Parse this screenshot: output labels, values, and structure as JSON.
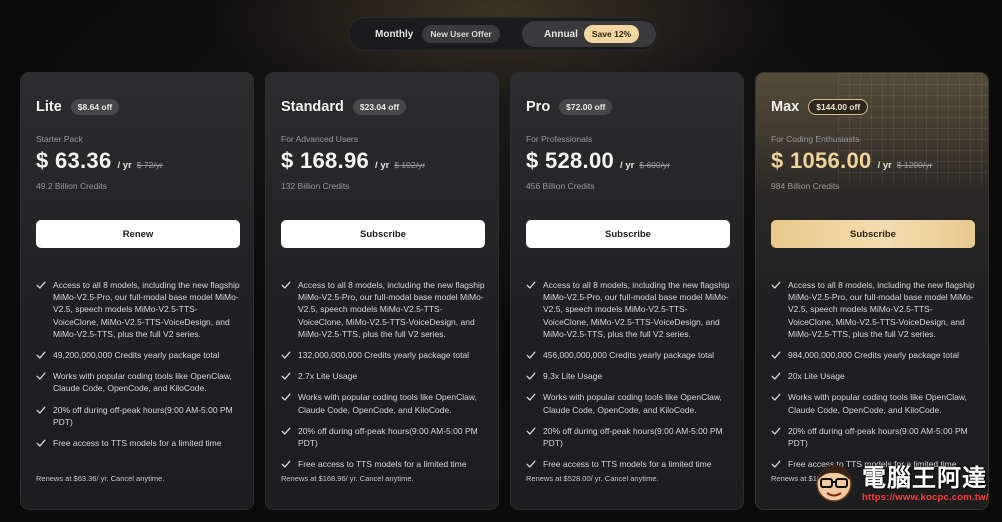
{
  "billing_toggle": {
    "monthly_label": "Monthly",
    "monthly_badge": "New User Offer",
    "annual_label": "Annual",
    "annual_badge": "Save 12%",
    "selected": "Annual"
  },
  "colors": {
    "accent_gold": "#f0d39a",
    "cta_white": "#ffffff",
    "card_bg": "#202123"
  },
  "plans": [
    {
      "name": "Lite",
      "discount": "$8.64 off",
      "tagline": "Starter Pack",
      "price": "$ 63.36",
      "period": "/ yr",
      "old_price": "$ 72/yr",
      "credits": "49.2 Billion Credits",
      "cta": "Renew",
      "features": [
        "Access to all 8 models, including the new flagship MiMo-V2.5-Pro, our full-modal base model MiMo-V2.5, speech models MiMo-V2.5-TTS-VoiceClone, MiMo-V2.5-TTS-VoiceDesign, and MiMo-V2.5-TTS, plus the full V2 series.",
        "49,200,000,000 Credits yearly package total",
        "Works with popular coding tools like OpenClaw, Claude Code, OpenCode, and KiloCode.",
        "20% off during off-peak hours(9:00 AM-5:00 PM PDT)",
        "Free access to TTS models for a limited time"
      ],
      "renew_note": "Renews at $63.36/ yr. Cancel anytime."
    },
    {
      "name": "Standard",
      "discount": "$23.04 off",
      "tagline": "For Advanced Users",
      "price": "$ 168.96",
      "period": "/ yr",
      "old_price": "$ 192/yr",
      "credits": "132 Billion Credits",
      "cta": "Subscribe",
      "features": [
        "Access to all 8 models, including the new flagship MiMo-V2.5-Pro, our full-modal base model MiMo-V2.5, speech models MiMo-V2.5-TTS-VoiceClone, MiMo-V2.5-TTS-VoiceDesign, and MiMo-V2.5-TTS, plus the full V2 series.",
        "132,000,000,000 Credits yearly package total",
        "2.7x Lite Usage",
        "Works with popular coding tools like OpenClaw, Claude Code, OpenCode, and KiloCode.",
        "20% off during off-peak hours(9:00 AM-5:00 PM PDT)",
        "Free access to TTS models for a limited time"
      ],
      "renew_note": "Renews at $168.96/ yr. Cancel anytime."
    },
    {
      "name": "Pro",
      "discount": "$72.00 off",
      "tagline": "For Professionals",
      "price": "$ 528.00",
      "period": "/ yr",
      "old_price": "$ 600/yr",
      "credits": "456 Billion Credits",
      "cta": "Subscribe",
      "features": [
        "Access to all 8 models, including the new flagship MiMo-V2.5-Pro, our full-modal base model MiMo-V2.5, speech models MiMo-V2.5-TTS-VoiceClone, MiMo-V2.5-TTS-VoiceDesign, and MiMo-V2.5-TTS, plus the full V2 series.",
        "456,000,000,000 Credits yearly package total",
        "9.3x Lite Usage",
        "Works with popular coding tools like OpenClaw, Claude Code, OpenCode, and KiloCode.",
        "20% off during off-peak hours(9:00 AM-5:00 PM PDT)",
        "Free access to TTS models for a limited time"
      ],
      "renew_note": "Renews at $528.00/ yr. Cancel anytime."
    },
    {
      "name": "Max",
      "discount": "$144.00 off",
      "tagline": "For Coding Enthusiasts",
      "price": "$ 1056.00",
      "period": "/ yr",
      "old_price": "$ 1200/yr",
      "credits": "984 Billion Credits",
      "cta": "Subscribe",
      "features": [
        "Access to all 8 models, including the new flagship MiMo-V2.5-Pro, our full-modal base model MiMo-V2.5, speech models MiMo-V2.5-TTS-VoiceClone, MiMo-V2.5-TTS-VoiceDesign, and MiMo-V2.5-TTS, plus the full V2 series.",
        "984,000,000,000 Credits yearly package total",
        "20x Lite Usage",
        "Works with popular coding tools like OpenClaw, Claude Code, OpenCode, and KiloCode.",
        "20% off during off-peak hours(9:00 AM-5:00 PM PDT)",
        "Free access to TTS models for a limited time"
      ],
      "renew_note": "Renews at $10"
    }
  ],
  "watermark": {
    "title": "電腦王阿達",
    "url": "https://www.kocpc.com.tw/"
  }
}
